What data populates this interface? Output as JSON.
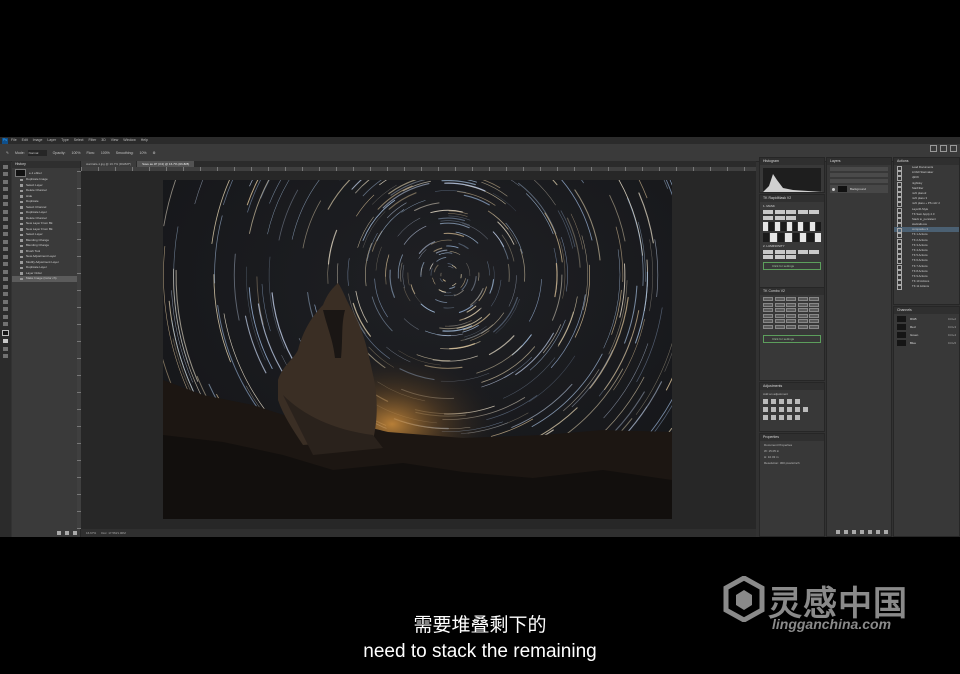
{
  "menu": {
    "logo": "Ps",
    "items": [
      "File",
      "Edit",
      "Image",
      "Layer",
      "Type",
      "Select",
      "Filter",
      "3D",
      "View",
      "Window",
      "Help"
    ]
  },
  "options_bar": {
    "mode_label": "Mode:",
    "mode_value": "Normal",
    "opacity_label": "Opacity:",
    "opacity_value": "100%",
    "flow_label": "Flow:",
    "flow_value": "100%",
    "smoothing_label": "Smoothing:",
    "smoothing_value": "10%"
  },
  "history_panel": {
    "title": "History",
    "snapshot": "e-1 ebbel",
    "items": [
      "Duplicate Image",
      "Select Layer",
      "Delete Channel",
      "Hide",
      "Duplicate",
      "Select Channel",
      "Duplicate Layer",
      "Delete Channel",
      "New Layer From Bk",
      "New Layer From Bk",
      "Select Layer",
      "Blending Change",
      "Blending Change",
      "Brush Tool",
      "New Adjustment Layer",
      "Modify Adjustment Layer",
      "Duplicate Layer",
      "Layer Order",
      "Make Image (Color ch)"
    ],
    "selected_index": 18
  },
  "tabs": [
    "startrails-1.jpg @ 16.7% (RGB/8*)",
    "Save as JP (3:2) @ 16.7% (RGB/8)"
  ],
  "status": {
    "zoom": "16.67%",
    "doc": "Doc: 17.5M/1.00M"
  },
  "panels": {
    "histogram_title": "Histogram",
    "layers_title": "Layers",
    "layer_name": "Background",
    "actions_title": "Actions",
    "actions": [
      "Lead Documents",
      "LOAD Starmaker",
      "q9CK",
      "nightsky",
      "StarFilter",
      "nsfz plano2",
      "nsfz plano 3",
      "nsfz plano + PS nsfz 2",
      "LayerR-Style",
      "TK Sam Apply 2.0",
      "Stack to_persistent",
      "startrails-ice",
      "composite-r1",
      "TK 1 Actions",
      "TK 2 Actions",
      "TK 3 Actions",
      "TK 4 Actions",
      "TK 5 Actions",
      "TK 6 Actions",
      "TK 7 Actions",
      "TK 8 Actions",
      "TK 9 Actions",
      "TK 10 Actions",
      "TK 11 Actions"
    ],
    "actions_selected": 12,
    "channels_title": "Channels",
    "channels": [
      {
        "name": "RGB",
        "shortcut": "Ctrl+2"
      },
      {
        "name": "Red",
        "shortcut": "Ctrl+3"
      },
      {
        "name": "Green",
        "shortcut": "Ctrl+4"
      },
      {
        "name": "Blue",
        "shortcut": "Ctrl+5"
      }
    ],
    "tk_panel_title": "TK RapidMask V2",
    "tk_panel2_title": "TK Combo V2",
    "click_for_settings": "Click for settings",
    "adjustments_title": "Adjustments",
    "adjustments_sub": "Add an adjustment",
    "properties_title": "Properties",
    "properties_sub": "Document Properties",
    "prop_w": "W: 15.05 in",
    "prop_h": "H: 10.03 in",
    "prop_res": "Resolution: 300 pixels/inch",
    "layer_mask": "1. MASK",
    "layer_mask2": "2. LUMINOSITY"
  },
  "subtitle": {
    "chinese": "需要堆叠剩下的",
    "english": "need to stack the remaining"
  },
  "watermark": {
    "brand_cn": "灵感中国",
    "brand_url": "lingganchina.com"
  }
}
